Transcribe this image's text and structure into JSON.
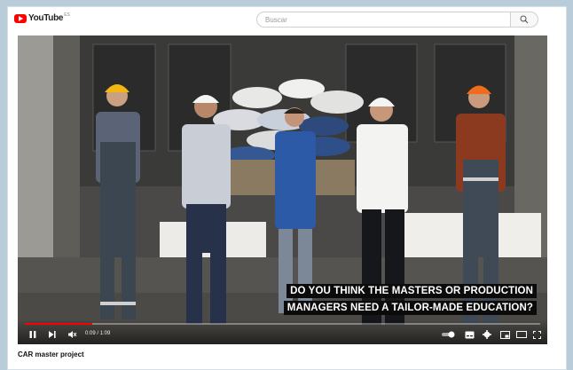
{
  "header": {
    "logo_text": "YouTube",
    "logo_country": "ES",
    "search_placeholder": "Buscar"
  },
  "video": {
    "caption_line1": "DO YOU THINK THE MASTERS OR PRODUCTION",
    "caption_line2": "MANAGERS NEED A TAILOR-MADE EDUCATION?",
    "time_display": "0:09 / 1:09",
    "progress_fraction": 0.13,
    "title": "CAR master project"
  },
  "colors": {
    "brand": "#ff0000",
    "page_background": "#b9ccd9"
  },
  "icons": [
    "youtube-logo-icon",
    "search-icon",
    "pause-icon",
    "next-icon",
    "mute-icon",
    "autoplay-toggle-icon",
    "subtitles-icon",
    "settings-icon",
    "miniplayer-icon",
    "theater-icon",
    "fullscreen-icon"
  ]
}
